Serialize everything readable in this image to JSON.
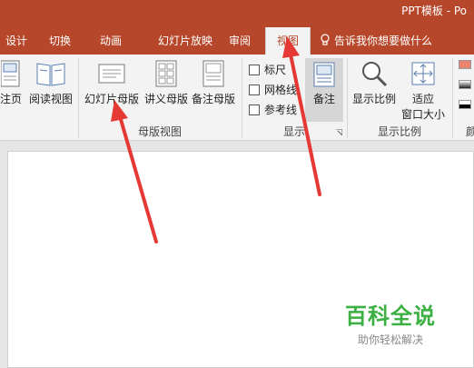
{
  "window": {
    "title": "PPT模板 - Po"
  },
  "tabs": [
    {
      "label": "设计"
    },
    {
      "label": "切换"
    },
    {
      "label": "动画"
    },
    {
      "label": "幻灯片放映"
    },
    {
      "label": "审阅"
    },
    {
      "label": "视图",
      "active": true
    }
  ],
  "tellme": {
    "label": "告诉我你想要做什么"
  },
  "ribbon": {
    "presentation_views": {
      "notes_page": "注页",
      "reading_view": "阅读视图"
    },
    "master_views": {
      "slide_master": "幻灯片母版",
      "handout_master": "讲义母版",
      "notes_master": "备注母版",
      "group_label": "母版视图"
    },
    "show": {
      "ruler": "标尺",
      "gridlines": "网格线",
      "guides": "参考线",
      "notes": "备注",
      "group_label": "显示"
    },
    "zoom": {
      "zoom": "显示比例",
      "fit_window_line1": "适应",
      "fit_window_line2": "窗口大小",
      "group_label": "显示比例"
    },
    "color_group_label": "颜"
  },
  "watermark": {
    "main": "百科全说",
    "sub": "助你轻松解决"
  },
  "colors": {
    "accent": "#b7472a",
    "watermark_green": "#3cb043",
    "arrow_red": "#e53935"
  }
}
